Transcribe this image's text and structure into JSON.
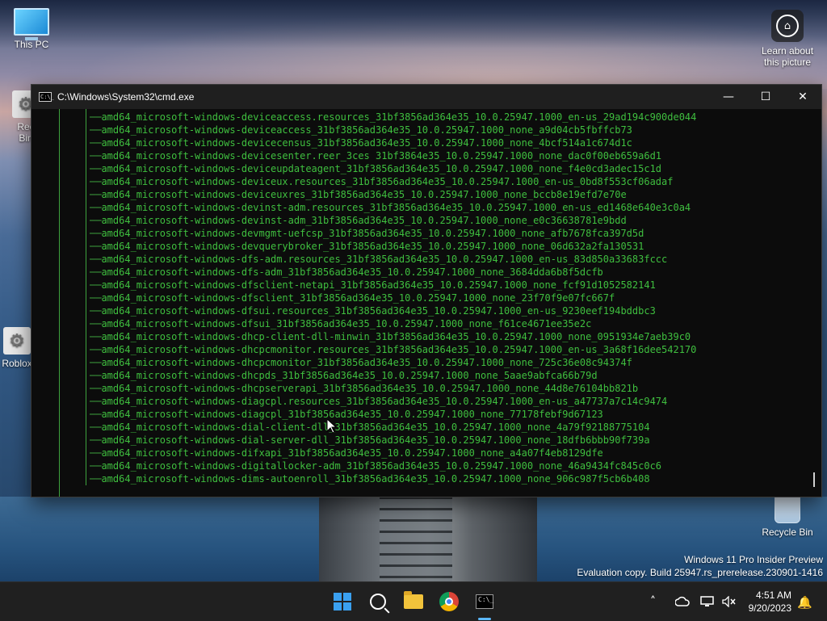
{
  "desktop": {
    "icons": [
      {
        "label": "This PC"
      },
      {
        "label": "Rec\nBin"
      },
      {
        "label": "Roblox"
      },
      {
        "label": "Recycle Bin"
      },
      {
        "label": "Learn about\nthis picture"
      }
    ],
    "watermark": {
      "line1": "Windows 11 Pro Insider Preview",
      "line2": "Evaluation copy. Build 25947.rs_prerelease.230901-1416"
    }
  },
  "window": {
    "title": "C:\\Windows\\System32\\cmd.exe",
    "title_icon_text": "C:\\_",
    "controls": {
      "minimize": "—",
      "maximize": "☐",
      "close": "✕"
    },
    "output_lines": [
      "amd64_microsoft-windows-deviceaccess.resources_31bf3856ad364e35_10.0.25947.1000_en-us_29ad194c900de044",
      "amd64_microsoft-windows-deviceaccess_31bf3856ad364e35_10.0.25947.1000_none_a9d04cb5fbffcb73",
      "amd64_microsoft-windows-devicecensus_31bf3856ad364e35_10.0.25947.1000_none_4bcf514a1c674d1c",
      "amd64_microsoft-windows-devicesenter.reer_3ces 31bf3864e35_10.0.25947.1000_none_dac0f00eb659a6d1",
      "amd64_microsoft-windows-deviceupdateagent_31bf3856ad364e35_10.0.25947.1000_none_f4e0cd3adec15c1d",
      "amd64_microsoft-windows-deviceux.resources_31bf3856ad364e35_10.0.25947.1000_en-us_0bd8f553cf06adaf",
      "amd64_microsoft-windows-deviceuxres_31bf3856ad364e35_10.0.25947.1000_none_bccb8e19efd7e70e",
      "amd64_microsoft-windows-devinst-adm.resources_31bf3856ad364e35_10.0.25947.1000_en-us_ed1468e640e3c0a4",
      "amd64_microsoft-windows-devinst-adm_31bf3856ad364e35_10.0.25947.1000_none_e0c36638781e9bdd",
      "amd64_microsoft-windows-devmgmt-uefcsp_31bf3856ad364e35_10.0.25947.1000_none_afb7678fca397d5d",
      "amd64_microsoft-windows-devquerybroker_31bf3856ad364e35_10.0.25947.1000_none_06d632a2fa130531",
      "amd64_microsoft-windows-dfs-adm.resources_31bf3856ad364e35_10.0.25947.1000_en-us_83d850a33683fccc",
      "amd64_microsoft-windows-dfs-adm_31bf3856ad364e35_10.0.25947.1000_none_3684dda6b8f5dcfb",
      "amd64_microsoft-windows-dfsclient-netapi_31bf3856ad364e35_10.0.25947.1000_none_fcf91d1052582141",
      "amd64_microsoft-windows-dfsclient_31bf3856ad364e35_10.0.25947.1000_none_23f70f9e07fc667f",
      "amd64_microsoft-windows-dfsui.resources_31bf3856ad364e35_10.0.25947.1000_en-us_9230eef194bddbc3",
      "amd64_microsoft-windows-dfsui_31bf3856ad364e35_10.0.25947.1000_none_f61ce4671ee35e2c",
      "amd64_microsoft-windows-dhcp-client-dll-minwin_31bf3856ad364e35_10.0.25947.1000_none_0951934e7aeb39c0",
      "amd64_microsoft-windows-dhcpcmonitor.resources_31bf3856ad364e35_10.0.25947.1000_en-us_3a68f16dee542170",
      "amd64_microsoft-windows-dhcpcmonitor_31bf3856ad364e35_10.0.25947.1000_none_725c36e08c94374f",
      "amd64_microsoft-windows-dhcpds_31bf3856ad364e35_10.0.25947.1000_none_5aae9abfca66b79d",
      "amd64_microsoft-windows-dhcpserverapi_31bf3856ad364e35_10.0.25947.1000_none_44d8e76104bb821b",
      "amd64_microsoft-windows-diagcpl.resources_31bf3856ad364e35_10.0.25947.1000_en-us_a47737a7c14c9474",
      "amd64_microsoft-windows-diagcpl_31bf3856ad364e35_10.0.25947.1000_none_77178febf9d67123",
      "amd64_microsoft-windows-dial-client-dll_31bf3856ad364e35_10.0.25947.1000_none_4a79f92188775104",
      "amd64_microsoft-windows-dial-server-dll_31bf3856ad364e35_10.0.25947.1000_none_18dfb6bbb90f739a",
      "amd64_microsoft-windows-difxapi_31bf3856ad364e35_10.0.25947.1000_none_a4a07f4eb8129dfe",
      "amd64_microsoft-windows-digitallocker-adm_31bf3856ad364e35_10.0.25947.1000_none_46a9434fc845c0c6",
      "amd64_microsoft-windows-dims-autoenroll_31bf3856ad364e35_10.0.25947.1000_none_906c987f5cb6b408"
    ]
  },
  "taskbar": {
    "apps": [
      {
        "name": "start",
        "icon": "windows-logo-icon"
      },
      {
        "name": "search",
        "icon": "search-icon"
      },
      {
        "name": "file-explorer",
        "icon": "folder-icon"
      },
      {
        "name": "chrome",
        "icon": "chrome-icon"
      },
      {
        "name": "command-prompt",
        "icon": "terminal-icon",
        "active": true
      }
    ],
    "tray": {
      "chevron": "˄",
      "time": "4:51 AM",
      "date": "9/20/2023"
    }
  },
  "colors": {
    "console_text": "#3fbf3f",
    "accent": "#5cb8ff"
  }
}
